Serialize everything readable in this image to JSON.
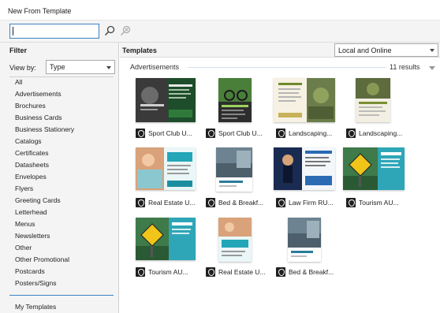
{
  "window": {
    "title": "New From Template"
  },
  "search": {
    "value": "",
    "search_icon": "search-icon",
    "clear_icon": "clear-search-icon"
  },
  "filter": {
    "header": "Filter",
    "view_by_label": "View by:",
    "view_by_value": "Type",
    "items": [
      "All",
      "Advertisements",
      "Brochures",
      "Business Cards",
      "Business Stationery",
      "Catalogs",
      "Certificates",
      "Datasheets",
      "Envelopes",
      "Flyers",
      "Greeting Cards",
      "Letterhead",
      "Menus",
      "Newsletters",
      "Other",
      "Other Promotional",
      "Postcards",
      "Posters/Signs"
    ],
    "my_templates": "My Templates"
  },
  "templates": {
    "header": "Templates",
    "source": "Local and Online",
    "category": "Advertisements",
    "results": "11 results",
    "items": [
      {
        "label": "Sport Club U...",
        "art": "sport1"
      },
      {
        "label": "Sport Club U...",
        "art": "sport2"
      },
      {
        "label": "Landscaping...",
        "art": "land1"
      },
      {
        "label": "Landscaping...",
        "art": "land2"
      },
      {
        "label": "Real Estate U...",
        "art": "estate1"
      },
      {
        "label": "Bed & Breakf...",
        "art": "bnb1"
      },
      {
        "label": "Law Firm RU...",
        "art": "law1"
      },
      {
        "label": "Tourism AU...",
        "art": "tour1"
      },
      {
        "label": "Tourism AU...",
        "art": "tour2"
      },
      {
        "label": "Real Estate U...",
        "art": "estate2"
      },
      {
        "label": "Bed & Breakf...",
        "art": "bnb2"
      }
    ]
  }
}
